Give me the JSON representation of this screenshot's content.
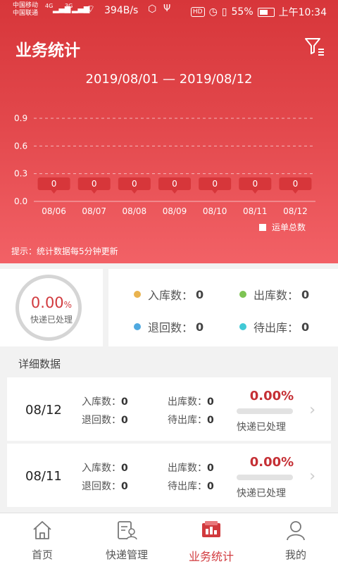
{
  "status_bar": {
    "carrier1": "中国移动",
    "carrier2": "中国联通",
    "sig1": "4G",
    "sig2": "3G",
    "net_speed": "394B/s",
    "hd": "HD",
    "battery": "55%",
    "time": "上午10:34"
  },
  "header": {
    "title": "业务统计",
    "date_range": "2019/08/01 — 2019/08/12"
  },
  "chart_data": {
    "type": "bar",
    "categories": [
      "08/06",
      "08/07",
      "08/08",
      "08/09",
      "08/10",
      "08/11",
      "08/12"
    ],
    "series": [
      {
        "name": "运单总数",
        "values": [
          0,
          0,
          0,
          0,
          0,
          0,
          0
        ]
      }
    ],
    "y_ticks": [
      "0.0",
      "0.3",
      "0.6",
      "0.9"
    ],
    "ylim": [
      0,
      0.9
    ],
    "grid": true,
    "legend_position": "bottom-right"
  },
  "legend_label": "运单总数",
  "tip": "提示：统计数据每5分钟更新",
  "summary": {
    "percent": "0.00",
    "percent_unit": "%",
    "processed_label": "快递已处理",
    "progress": 0,
    "stats": [
      {
        "label": "入库数：",
        "value": "0",
        "color": "#e9b34f"
      },
      {
        "label": "出库数：",
        "value": "0",
        "color": "#7dc353"
      },
      {
        "label": "退回数：",
        "value": "0",
        "color": "#4fa9e0"
      },
      {
        "label": "待出库：",
        "value": "0",
        "color": "#41c9d6"
      }
    ]
  },
  "details_title": "详细数据",
  "details": [
    {
      "date": "08/12",
      "in_label": "入库数：",
      "in": "0",
      "out_label": "出库数：",
      "out": "0",
      "ret_label": "退回数：",
      "ret": "0",
      "pend_label": "待出库：",
      "pend": "0",
      "percent": "0.00%",
      "progress": 0,
      "processed": "快递已处理"
    },
    {
      "date": "08/11",
      "in_label": "入库数：",
      "in": "0",
      "out_label": "出库数：",
      "out": "0",
      "ret_label": "退回数：",
      "ret": "0",
      "pend_label": "待出库：",
      "pend": "0",
      "percent": "0.00%",
      "progress": 0,
      "processed": "快递已处理"
    }
  ],
  "tabs": [
    {
      "label": "首页",
      "icon": "home-icon",
      "active": false
    },
    {
      "label": "快递管理",
      "icon": "clipboard-person-icon",
      "active": false
    },
    {
      "label": "业务统计",
      "icon": "statistics-icon",
      "active": true
    },
    {
      "label": "我的",
      "icon": "user-icon",
      "active": false
    }
  ],
  "colors": {
    "primary": "#d13a3e",
    "header_top": "#d7363a",
    "header_bottom": "#f26166"
  }
}
